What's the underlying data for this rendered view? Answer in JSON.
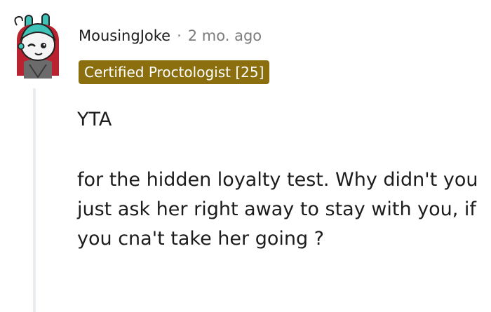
{
  "comment": {
    "username": "MousingJoke",
    "separator": "·",
    "timestamp": "2 mo. ago",
    "flair": "Certified Proctologist [25]",
    "verdict": "YTA",
    "paragraph": "for the hidden loyalty test. Why didn't you just ask her right away to stay with you, if you cna't take her going ?"
  },
  "colors": {
    "flair_background": "#8b6f0e",
    "avatar_teal": "#3fc3b8",
    "avatar_red": "#b8232f"
  }
}
